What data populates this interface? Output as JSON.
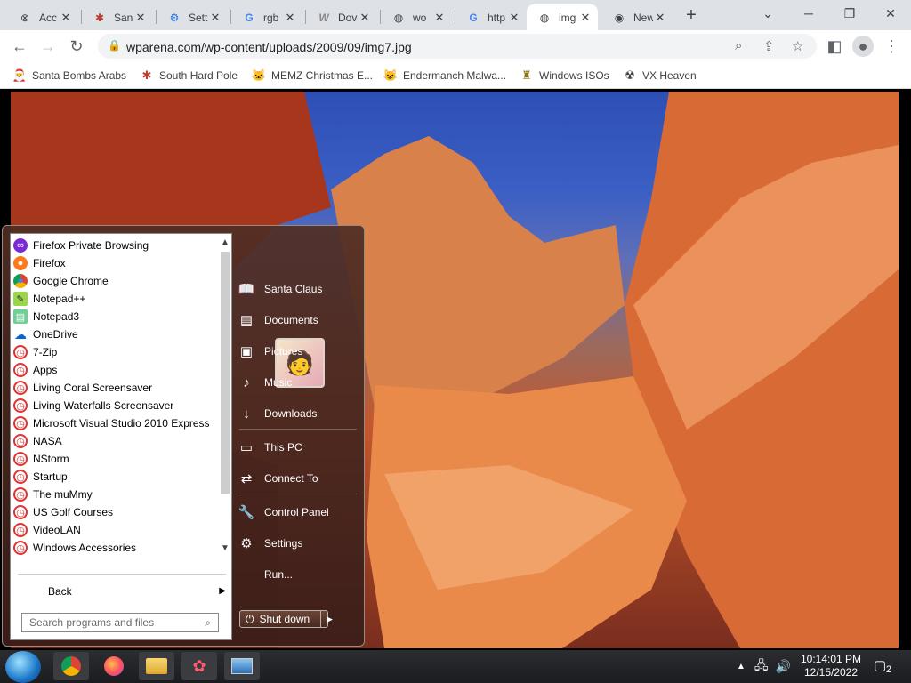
{
  "tabs": [
    {
      "icon": "steam-like-icon",
      "title": "Acc"
    },
    {
      "icon": "snowflake-icon",
      "title": "San"
    },
    {
      "icon": "gear-icon",
      "title": "Sett"
    },
    {
      "icon": "google-icon",
      "title": "rgb"
    },
    {
      "icon": "w-logo-icon",
      "title": "Dov"
    },
    {
      "icon": "globe-icon",
      "title": "wo"
    },
    {
      "icon": "google-icon",
      "title": "http"
    },
    {
      "icon": "globe-icon",
      "title": "img"
    },
    {
      "icon": "chrome-icon",
      "title": "New Tab"
    }
  ],
  "address": {
    "url": "wparena.com/wp-content/uploads/2009/09/img7.jpg"
  },
  "bookmarks": [
    {
      "icon": "santa-icon",
      "label": "Santa Bombs Arabs"
    },
    {
      "icon": "snowflake-icon",
      "label": "South Hard Pole"
    },
    {
      "icon": "nyan-icon",
      "label": "MEMZ Christmas E..."
    },
    {
      "icon": "cat-icon",
      "label": "Endermanch Malwa..."
    },
    {
      "icon": "trophy-icon",
      "label": "Windows ISOs"
    },
    {
      "icon": "vx-icon",
      "label": "VX Heaven"
    }
  ],
  "startmenu": {
    "programs": [
      {
        "icon": "firefox-private-icon",
        "label": "Firefox Private Browsing"
      },
      {
        "icon": "firefox-icon",
        "label": "Firefox"
      },
      {
        "icon": "chrome-icon",
        "label": "Google Chrome"
      },
      {
        "icon": "notepadpp-icon",
        "label": "Notepad++"
      },
      {
        "icon": "notepad3-icon",
        "label": "Notepad3"
      },
      {
        "icon": "onedrive-icon",
        "label": "OneDrive"
      },
      {
        "icon": "folder-clock-icon",
        "label": "7-Zip"
      },
      {
        "icon": "folder-clock-icon",
        "label": "Apps"
      },
      {
        "icon": "folder-clock-icon",
        "label": "Living Coral Screensaver"
      },
      {
        "icon": "folder-clock-icon",
        "label": "Living Waterfalls Screensaver"
      },
      {
        "icon": "folder-clock-icon",
        "label": "Microsoft Visual Studio 2010 Express"
      },
      {
        "icon": "folder-clock-icon",
        "label": "NASA"
      },
      {
        "icon": "folder-clock-icon",
        "label": "NStorm"
      },
      {
        "icon": "folder-clock-icon",
        "label": "Startup"
      },
      {
        "icon": "folder-clock-icon",
        "label": "The muMmy"
      },
      {
        "icon": "folder-clock-icon",
        "label": "US Golf Courses"
      },
      {
        "icon": "folder-clock-icon",
        "label": "VideoLAN"
      },
      {
        "icon": "folder-clock-icon",
        "label": "Windows Accessories"
      }
    ],
    "back_label": "Back",
    "search_placeholder": "Search programs and files",
    "right_items": [
      {
        "icon": "user-book-icon",
        "label": "Santa Claus"
      },
      {
        "icon": "document-icon",
        "label": "Documents"
      },
      {
        "icon": "picture-icon",
        "label": "Pictures"
      },
      {
        "icon": "music-note-icon",
        "label": "Music"
      },
      {
        "icon": "download-icon",
        "label": "Downloads"
      },
      {
        "icon": "computer-icon",
        "label": "This PC"
      },
      {
        "icon": "network-icon",
        "label": "Connect To"
      },
      {
        "icon": "wrench-icon",
        "label": "Control Panel"
      },
      {
        "icon": "gear-icon",
        "label": "Settings"
      },
      {
        "icon": "run-icon",
        "label": "Run..."
      }
    ],
    "shutdown_label": "Shut down"
  },
  "taskbar": {
    "clock_time": "10:14:01 PM",
    "clock_date": "12/15/2022",
    "notification_count": "2"
  }
}
